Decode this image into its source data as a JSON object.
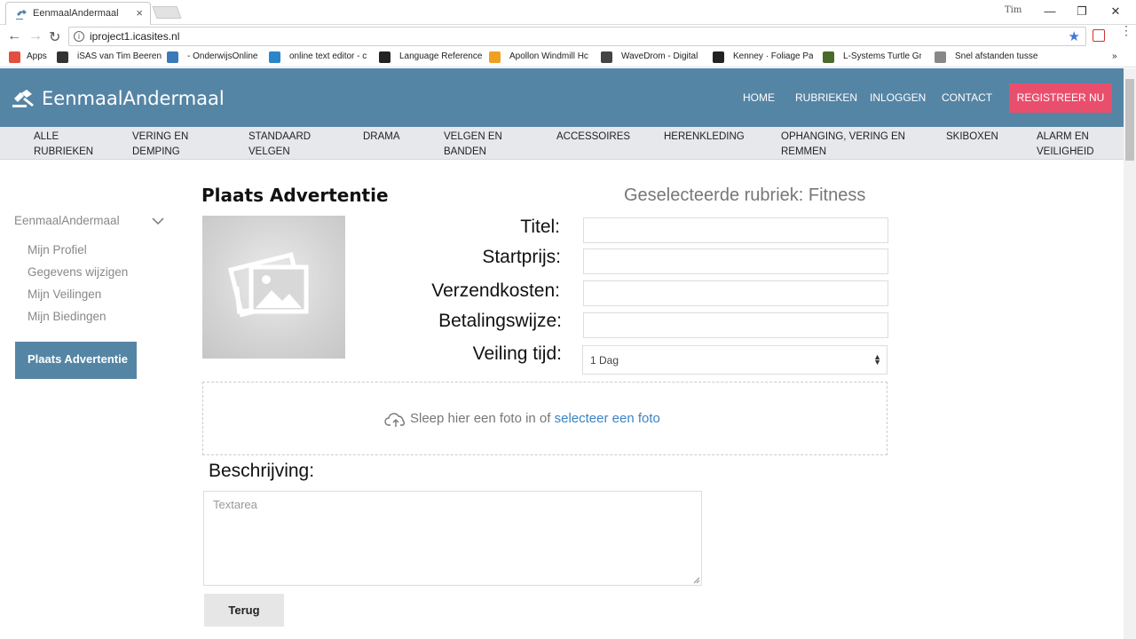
{
  "browser": {
    "tab_title": "EenmaalAndermaal",
    "url": "iproject1.icasites.nl",
    "user_name": "Tim",
    "bookmarks": [
      {
        "label": "Apps",
        "color": "#e04f3f"
      },
      {
        "label": "iSAS van Tim Beeren",
        "color": "#333333"
      },
      {
        "label": "- OnderwijsOnline",
        "color": "#3a7ab8"
      },
      {
        "label": "online text editor - c",
        "color": "#2a85c9"
      },
      {
        "label": "Language Reference",
        "color": "#222222"
      },
      {
        "label": "Apollon Windmill Hc",
        "color": "#f0a020"
      },
      {
        "label": "WaveDrom - Digital",
        "color": "#444444"
      },
      {
        "label": "Kenney · Foliage Pac",
        "color": "#222222"
      },
      {
        "label": "L-Systems Turtle Gra",
        "color": "#4a6a2a"
      },
      {
        "label": "Snel afstanden tusse",
        "color": "#888888"
      }
    ]
  },
  "site": {
    "logo": "EenmaalAndermaal",
    "nav": [
      "HOME",
      "RUBRIEKEN",
      "INLOGGEN",
      "CONTACT"
    ],
    "register": "REGISTREER NU",
    "brand_color": "#5585a5",
    "accent_color": "#e94f6d",
    "categories": [
      [
        "ALLE",
        "RUBRIEKEN"
      ],
      [
        "VERING EN",
        "DEMPING"
      ],
      [
        "STANDAARD",
        "VELGEN"
      ],
      [
        "DRAMA",
        ""
      ],
      [
        "VELGEN EN",
        "BANDEN"
      ],
      [
        "ACCESSOIRES",
        ""
      ],
      [
        "HERENKLEDING",
        ""
      ],
      [
        "OPHANGING, VERING EN",
        "REMMEN"
      ],
      [
        "SKIBOXEN",
        ""
      ],
      [
        "ALARM EN",
        "VEILIGHEID"
      ]
    ]
  },
  "sidebar": {
    "header": "EenmaalAndermaal",
    "items": [
      "Mijn Profiel",
      "Gegevens wijzigen",
      "Mijn Veilingen",
      "Mijn Biedingen"
    ],
    "active_button": "Plaats Advertentie"
  },
  "form": {
    "heading": "Plaats Advertentie",
    "selected_category": "Geselecteerde rubriek: Fitness",
    "labels": {
      "title": "Titel:",
      "start_price": "Startprijs:",
      "shipping": "Verzendkosten:",
      "payment": "Betalingswijze:",
      "auction_time": "Veiling tijd:"
    },
    "values": {
      "title": "",
      "start_price": "",
      "shipping": "",
      "payment": ""
    },
    "auction_time_value": "1 Dag",
    "dropzone_text": "Sleep hier een foto in of ",
    "dropzone_link": "selecteer een foto",
    "description_label": "Beschrijving:",
    "description_placeholder": "Textarea",
    "back_button": "Terug"
  }
}
